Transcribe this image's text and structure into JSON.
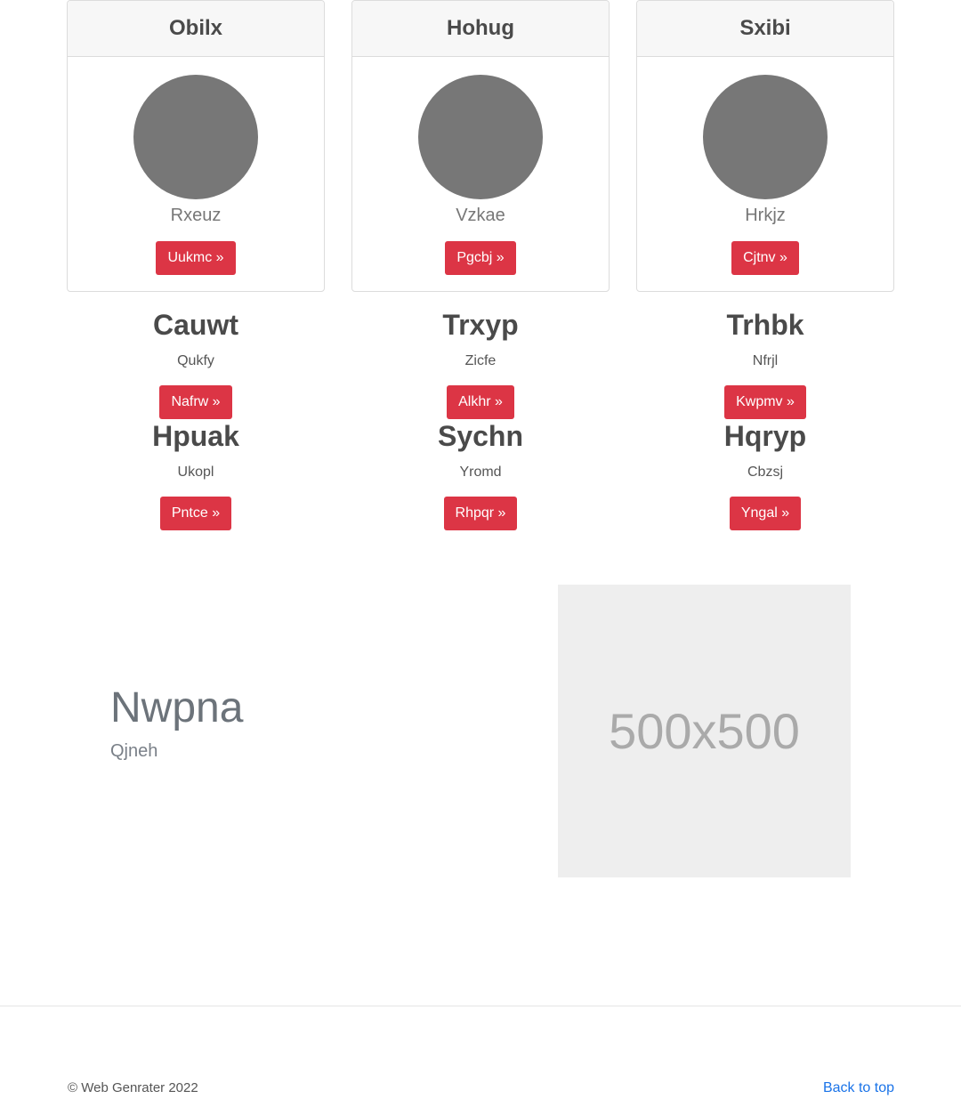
{
  "cards": [
    {
      "title": "Obilx",
      "subtitle": "Rxeuz",
      "button": "Uukmc »"
    },
    {
      "title": "Hohug",
      "subtitle": "Vzkae",
      "button": "Pgcbj »"
    },
    {
      "title": "Sxibi",
      "subtitle": "Hrkjz",
      "button": "Cjtnv »"
    }
  ],
  "features_row1": [
    {
      "title": "Cauwt",
      "text": "Qukfy",
      "button": "Nafrw »"
    },
    {
      "title": "Trxyp",
      "text": "Zicfe",
      "button": "Alkhr »"
    },
    {
      "title": "Trhbk",
      "text": "Nfrjl",
      "button": "Kwpmv »"
    }
  ],
  "features_row2": [
    {
      "title": "Hpuak",
      "text": "Ukopl",
      "button": "Pntce »"
    },
    {
      "title": "Sychn",
      "text": "Yromd",
      "button": "Rhpqr »"
    },
    {
      "title": "Hqryp",
      "text": "Cbzsj",
      "button": "Yngal »"
    }
  ],
  "hero": {
    "title": "Nwpna",
    "subtitle": "Qjneh",
    "image_label": "500x500"
  },
  "footer": {
    "copyright": "© Web Genrater 2022",
    "back_to_top": "Back to top"
  },
  "colors": {
    "button": "#dc3545",
    "link": "#1a73e8",
    "avatar": "#777777"
  }
}
